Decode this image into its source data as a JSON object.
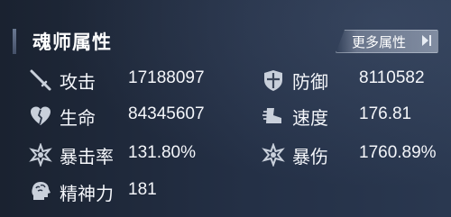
{
  "header": {
    "title": "魂师属性",
    "more_button_label": "更多属性"
  },
  "stats": {
    "attack": {
      "label": "攻击",
      "value": "17188097",
      "icon": "sword-icon"
    },
    "defense": {
      "label": "防御",
      "value": "8110582",
      "icon": "shield-icon"
    },
    "hp": {
      "label": "生命",
      "value": "84345607",
      "icon": "heart-icon"
    },
    "speed": {
      "label": "速度",
      "value": "176.81",
      "icon": "boot-icon"
    },
    "crit_rate": {
      "label": "暴击率",
      "value": "131.80%",
      "icon": "crit-burst-icon"
    },
    "crit_damage": {
      "label": "暴伤",
      "value": "1760.89%",
      "icon": "crit-burst-icon"
    },
    "spirit": {
      "label": "精神力",
      "value": "181",
      "icon": "brain-head-icon"
    }
  },
  "colors": {
    "text": "#f4f6fa",
    "icon": "#c9d0db",
    "background": "#1e2738"
  }
}
